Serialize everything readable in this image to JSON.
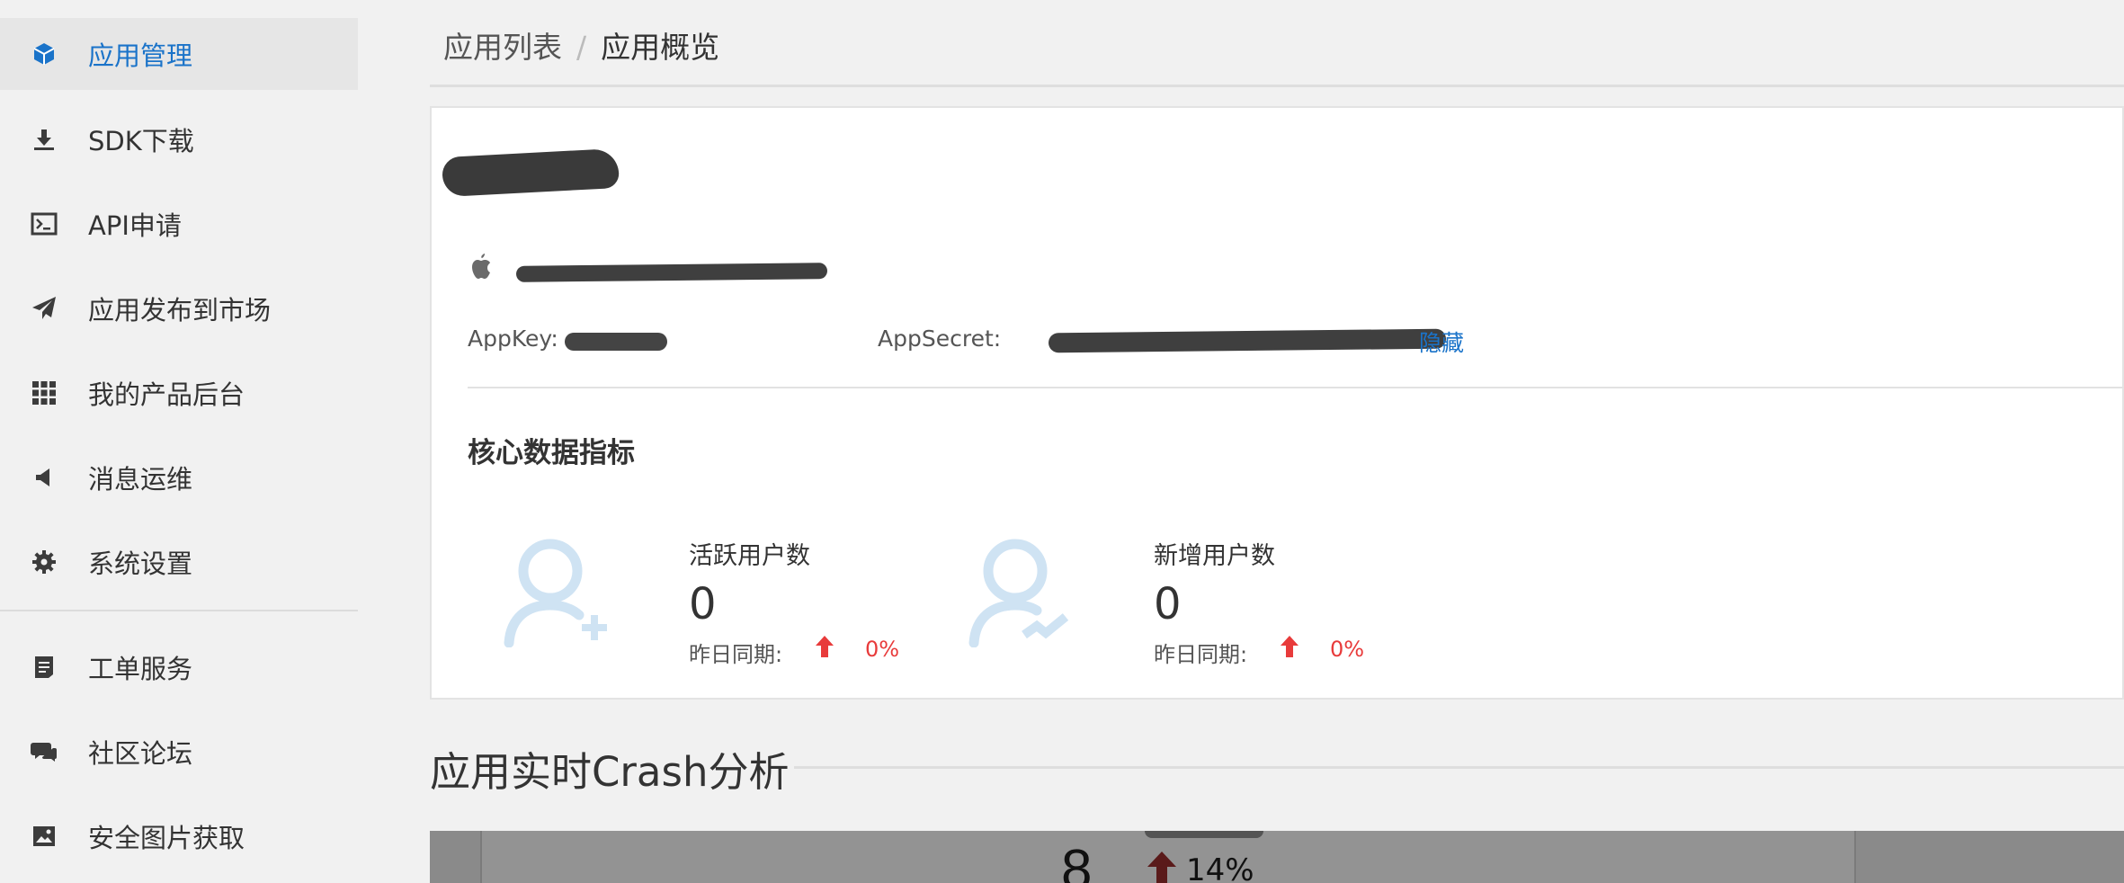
{
  "sidebar": {
    "items": [
      {
        "label": "应用管理",
        "icon": "cube-icon",
        "active": true
      },
      {
        "label": "SDK下载",
        "icon": "download-icon"
      },
      {
        "label": "API申请",
        "icon": "terminal-icon"
      },
      {
        "label": "应用发布到市场",
        "icon": "paper-plane-icon"
      },
      {
        "label": "我的产品后台",
        "icon": "grid-icon"
      },
      {
        "label": "消息运维",
        "icon": "megaphone-icon"
      },
      {
        "label": "系统设置",
        "icon": "gear-icon"
      },
      {
        "label": "工单服务",
        "icon": "ticket-icon"
      },
      {
        "label": "社区论坛",
        "icon": "chat-icon"
      },
      {
        "label": "安全图片获取",
        "icon": "image-icon"
      }
    ]
  },
  "breadcrumb": {
    "parent": "应用列表",
    "separator": "/",
    "current": "应用概览"
  },
  "app": {
    "appkey_label": "AppKey:",
    "appsecret_label": "AppSecret:",
    "hide_label": "隐藏"
  },
  "metrics": {
    "title": "核心数据指标",
    "items": [
      {
        "label": "活跃用户数",
        "value": "0",
        "compare_label": "昨日同期:",
        "change": "0%",
        "icon": "user-add-icon"
      },
      {
        "label": "新增用户数",
        "value": "0",
        "compare_label": "昨日同期:",
        "change": "0%",
        "icon": "user-trend-icon"
      }
    ]
  },
  "crash": {
    "title": "应用实时Crash分析",
    "count": "8",
    "change": "14%"
  },
  "colors": {
    "accent": "#1a73c9",
    "up": "#e83b3b",
    "icon_light": "#cfe3f3"
  }
}
